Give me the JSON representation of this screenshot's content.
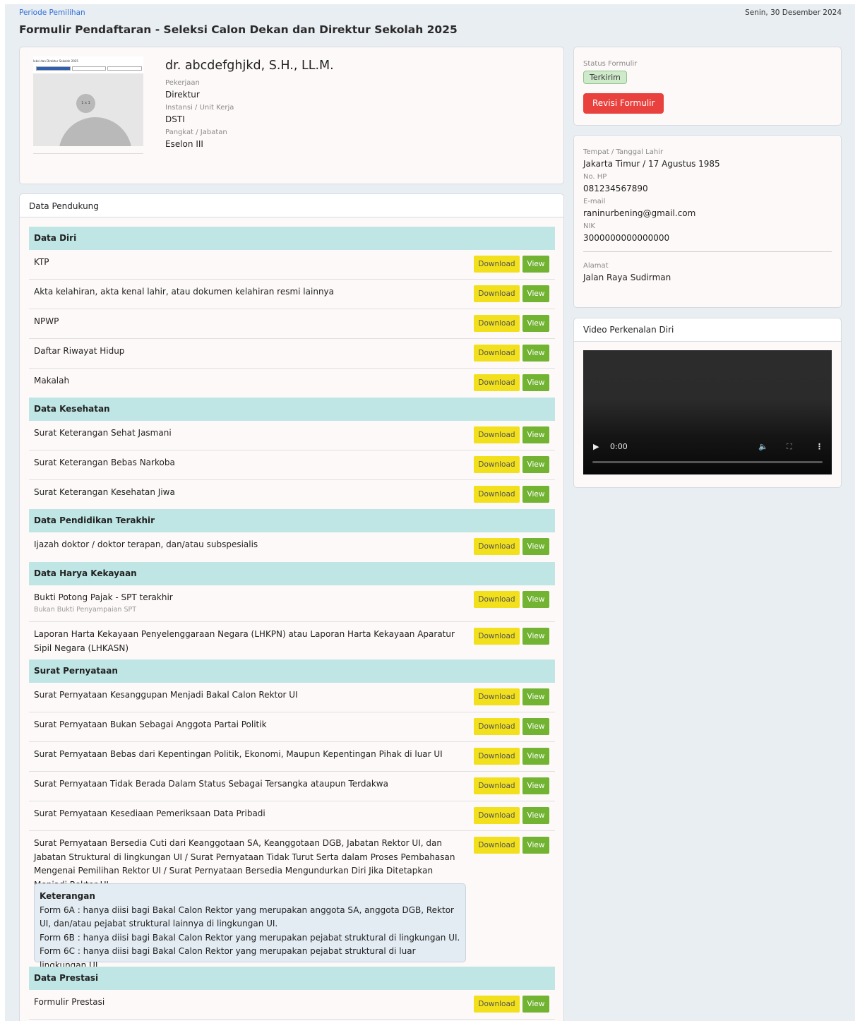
{
  "header": {
    "breadcrumb": "Periode Pemilihan",
    "date": "Senin, 30 Desember 2024",
    "title": "Formulir Pendaftaran - Seleksi Calon Dekan dan Direktur Sekolah 2025"
  },
  "profile": {
    "name": "dr. abcdefghjkd, S.H., LL.M.",
    "photo_caption": "1 x 1",
    "photo_strip_title": "leksi dan Direktur Sekolah 2025",
    "pekerjaan_label": "Pekerjaan",
    "pekerjaan": "Direktur",
    "instansi_label": "Instansi / Unit Kerja",
    "instansi": "DSTI",
    "pangkat_label": "Pangkat / Jabatan",
    "pangkat": "Eselon III"
  },
  "status": {
    "label": "Status Formulir",
    "badge": "Terkirim",
    "badge_color": "#cfeacb",
    "revisi_button": "Revisi Formulir",
    "revisi_color": "#e8413e"
  },
  "personal": {
    "ttl_label": "Tempat / Tanggal Lahir",
    "ttl": "Jakarta Timur / 17 Agustus 1985",
    "hp_label": "No. HP",
    "hp": "081234567890",
    "email_label": "E-mail",
    "email": "raninurbening@gmail.com",
    "nik_label": "NIK",
    "nik": "3000000000000000",
    "alamat_label": "Alamat",
    "alamat": "Jalan Raya Sudirman"
  },
  "video": {
    "title": "Video Perkenalan Diri",
    "time": "0:00"
  },
  "dp": {
    "title": "Data Pendukung",
    "download_label": "Download",
    "view_label": "View",
    "sections": {
      "diri": "Data Diri",
      "kesehatan": "Data Kesehatan",
      "pendidikan": "Data Pendidikan Terakhir",
      "harta": "Data Harya Kekayaan",
      "pernyataan": "Surat Pernyataan",
      "prestasi": "Data Prestasi"
    },
    "items": {
      "ktp": "KTP",
      "akta": "Akta kelahiran, akta kenal lahir, atau dokumen kelahiran resmi lainnya",
      "npwp": "NPWP",
      "cv": "Daftar Riwayat Hidup",
      "makalah": "Makalah",
      "sehat": "Surat Keterangan Sehat Jasmani",
      "narkoba": "Surat Keterangan Bebas Narkoba",
      "jiwa": "Surat Keterangan Kesehatan Jiwa",
      "ijazah": "Ijazah doktor / doktor terapan, dan/atau subspesialis",
      "spt": "Bukti Potong Pajak - SPT terakhir",
      "spt_sub": "Bukan Bukti Penyampaian SPT",
      "lhkpn": "Laporan Harta Kekayaan Penyelenggaraan Negara (LHKPN) atau Laporan Harta Kekayaan Aparatur Sipil Negara (LHKASN)",
      "sanggup": "Surat Pernyataan Kesanggupan Menjadi Bakal Calon Rektor UI",
      "partai": "Surat Pernyataan Bukan Sebagai Anggota Partai Politik",
      "kepentingan": "Surat Pernyataan Bebas dari Kepentingan Politik, Ekonomi, Maupun Kepentingan Pihak di luar UI",
      "tersangka": "Surat Pernyataan Tidak Berada Dalam Status Sebagai Tersangka ataupun Terdakwa",
      "pribadi": "Surat Pernyataan Kesediaan Pemeriksaan Data Pribadi",
      "cuti": "Surat Pernyataan Bersedia Cuti dari Keanggotaan SA, Keanggotaan DGB, Jabatan Rektor UI, dan Jabatan Struktural di lingkungan UI / Surat Pernyataan Tidak Turut Serta dalam Proses Pembahasan Mengenai Pemilihan Rektor UI / Surat Pernyataan Bersedia Mengundurkan Diri Jika Ditetapkan Menjadi Rektor UI",
      "prestasi": "Formulir Prestasi"
    },
    "note": {
      "title": "Keterangan",
      "l1": "Form 6A : hanya diisi bagi Bakal Calon Rektor yang merupakan anggota SA, anggota DGB, Rektor UI, dan/atau pejabat struktural lainnya di lingkungan UI.",
      "l2": "Form 6B : hanya diisi bagi Bakal Calon Rektor yang merupakan pejabat struktural di lingkungan UI.",
      "l3": "Form 6C : hanya diisi bagi Bakal Calon Rektor yang merupakan pejabat struktural di luar lingkungan UI."
    }
  }
}
